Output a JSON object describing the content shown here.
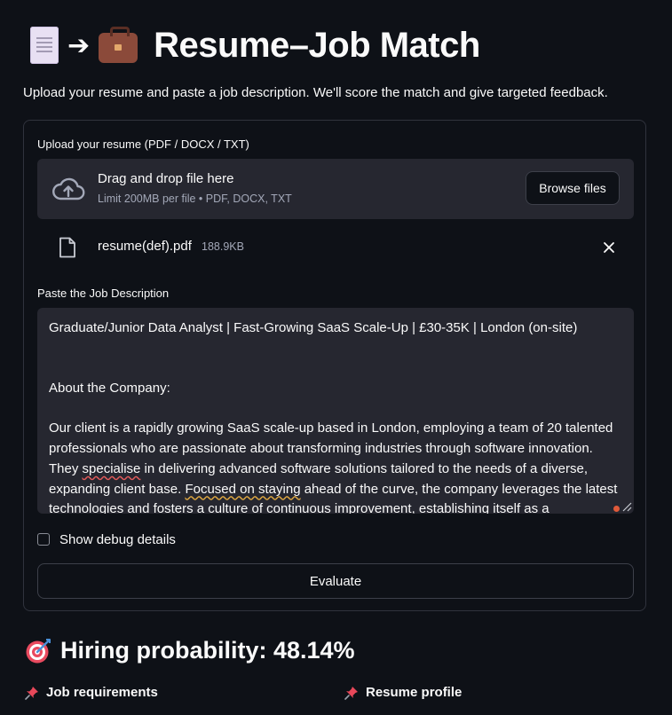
{
  "header": {
    "title": "Resume–Job Match",
    "arrow": "➔",
    "subtitle": "Upload your resume and paste a job description. We'll score the match and give targeted feedback."
  },
  "uploader": {
    "label": "Upload your resume (PDF / DOCX / TXT)",
    "drop_title": "Drag and drop file here",
    "drop_limit": "Limit 200MB per file • PDF, DOCX, TXT",
    "browse_label": "Browse files",
    "file": {
      "name": "resume(def).pdf",
      "size": "188.9KB"
    }
  },
  "job_description": {
    "label": "Paste the Job Description",
    "line1": "Graduate/Junior Data Analyst | Fast-Growing SaaS Scale-Up | £30-35K | London (on-site)",
    "line2": "About the Company:",
    "para_a": "Our client is a rapidly growing SaaS scale-up based in London, employing a team of 20 talented professionals who are passionate about transforming industries through software innovation. They ",
    "spell_word": "specialise",
    "para_b": " in delivering advanced software solutions tailored to the needs of a diverse, expanding client base. ",
    "grammar_phrase": "Focused on staying",
    "para_c": " ahead of the curve, the company leverages the latest technologies and fosters a culture of continuous improvement, establishing itself as a"
  },
  "debug": {
    "label": "Show debug details",
    "checked": false
  },
  "evaluate_label": "Evaluate",
  "result": {
    "heading": "Hiring probability: 48.14%",
    "col_left": "Job requirements",
    "col_right": "Resume profile"
  },
  "colors": {
    "background": "#0e1117",
    "surface": "#262730",
    "border": "#30333d",
    "text": "#fafafa",
    "muted": "#a3a8b8"
  },
  "icons": [
    "document-icon",
    "briefcase-icon",
    "upload-cloud-icon",
    "file-icon",
    "close-icon",
    "target-icon",
    "pushpin-icon"
  ]
}
